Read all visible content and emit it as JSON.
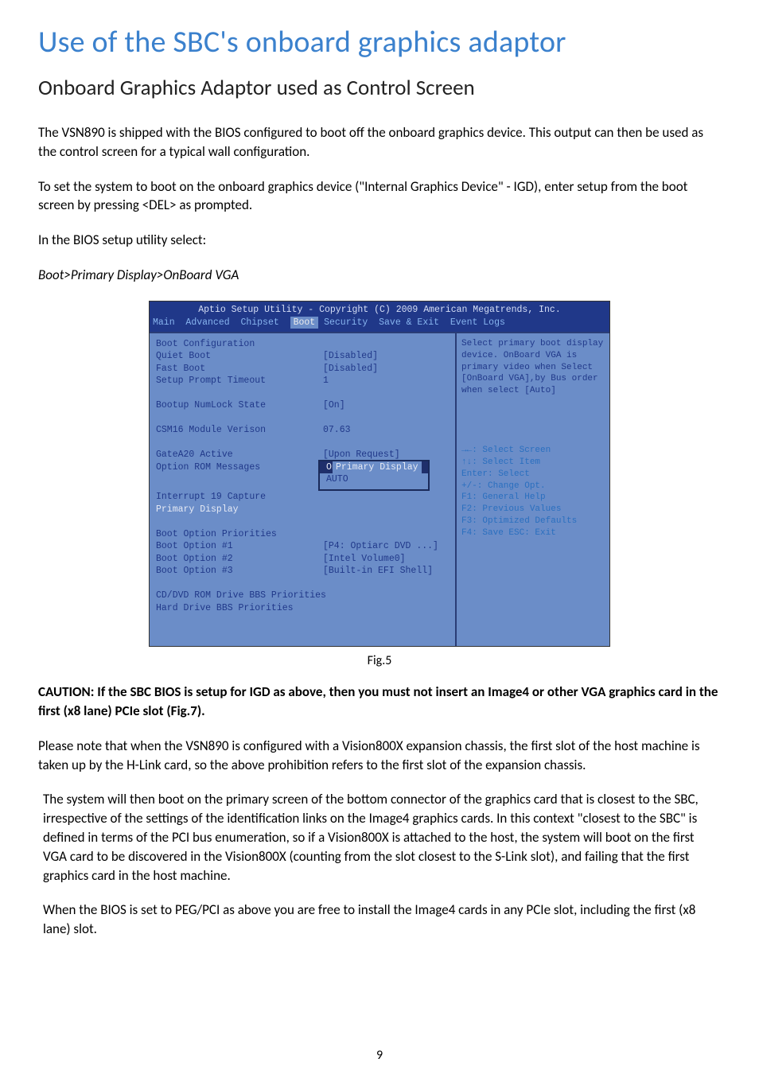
{
  "title": "Use of the SBC's onboard graphics adaptor",
  "subtitle": "Onboard Graphics Adaptor used as Control Screen",
  "p1": "The VSN890 is shipped with the BIOS configured to boot off the onboard graphics device.  This output can then be used as the control screen for a typical wall configuration.",
  "p2": "To set the system to boot on the onboard graphics device (\"Internal Graphics Device\" - IGD), enter setup from the boot screen by pressing <DEL> as prompted.",
  "p3": "In the BIOS setup utility select:",
  "p4": "Boot>Primary Display>OnBoard VGA",
  "bios": {
    "header": "Aptio Setup Utility - Copyright (C) 2009 American Megatrends, Inc.",
    "menu": {
      "main": "Main",
      "advanced": "Advanced",
      "chipset": "Chipset",
      "boot": "Boot",
      "security": "Security",
      "save": "Save & Exit",
      "event": "Event Logs"
    },
    "left": {
      "section": "Boot Configuration",
      "quiet_label": "Quiet Boot",
      "quiet_val": "[Disabled]",
      "fast_label": "Fast Boot",
      "fast_val": "[Disabled]",
      "timeout_label": "Setup Prompt Timeout",
      "timeout_val": "1",
      "numlock_label": "Bootup NumLock State",
      "numlock_val": "[On]",
      "csm_label": "CSM16 Module Verison",
      "csm_val": "07.63",
      "gate_label": "GateA20 Active",
      "gate_val": "[Upon Request]",
      "rom_label": "Option ROM Messages",
      "int19_label": "Interrupt 19 Capture",
      "primary_label": "Primary Display",
      "popup_title": "Primary Display",
      "popup_opt1": "OnBoard VGA",
      "popup_opt2": "AUTO",
      "priorities": "Boot Option Priorities",
      "bo1_label": "Boot Option #1",
      "bo1_val": "[P4: Optiarc DVD ...]",
      "bo2_label": "Boot Option #2",
      "bo2_val": "[Intel Volume0]",
      "bo3_label": "Boot Option #3",
      "bo3_val": "[Built-in EFI Shell]",
      "cddvd": "CD/DVD ROM Drive BBS Priorities",
      "hdd": "Hard Drive BBS Priorities"
    },
    "right": {
      "help": "Select primary boot display device. OnBoard VGA is primary video when Select [OnBoard VGA],by Bus order when select [Auto]",
      "k1": "→←: Select Screen",
      "k2": "↑↓: Select Item",
      "k3": "Enter: Select",
      "k4": "+/-: Change Opt.",
      "k5": "F1: General Help",
      "k6": "F2: Previous Values",
      "k7": "F3: Optimized Defaults",
      "k8": "F4: Save  ESC: Exit"
    }
  },
  "fig": "Fig.5",
  "caution": "CAUTION:  If the SBC BIOS is setup for IGD as above, then you must not insert an Image4 or other VGA graphics card in the first (x8 lane) PCIe slot (Fig.7).",
  "p5": "Please note that when the VSN890 is configured with a Vision800X expansion chassis, the first slot of the host machine is taken up by the H-Link card, so the above prohibition refers to the first slot of the expansion chassis.",
  "p6": "The system will then boot on the primary screen of the bottom connector of the graphics card that is closest to the SBC, irrespective of the settings of the identification links on the Image4 graphics cards.  In this context \"closest to the SBC\" is defined in terms of the PCI bus enumeration, so if a Vision800X is attached to the host, the system will boot on the first VGA card to be discovered in the Vision800X (counting from the slot closest to the S-Link slot), and failing that the first graphics card in the host machine.",
  "p7": "When the BIOS is set to PEG/PCI as above you are free to install the Image4 cards in any PCIe slot, including the first (x8 lane) slot.",
  "pagenum": "9"
}
